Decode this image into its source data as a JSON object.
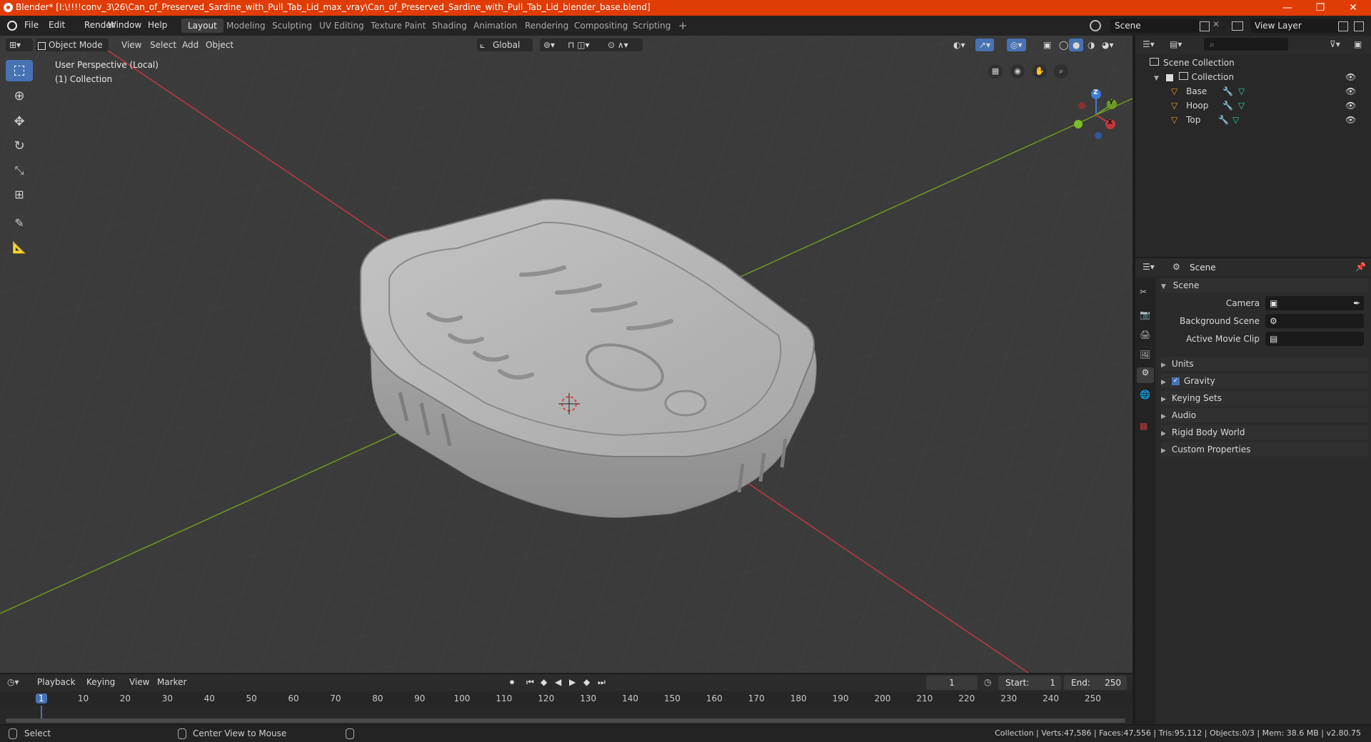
{
  "window": {
    "title": "Blender* [I:\\!!!!conv_3\\26\\Can_of_Preserved_Sardine_with_Pull_Tab_Lid_max_vray\\Can_of_Preserved_Sardine_with_Pull_Tab_Lid_blender_base.blend]",
    "minimize": "—",
    "restore": "❐",
    "close": "✕"
  },
  "menubar": {
    "items": [
      "File",
      "Edit",
      "Render",
      "Window",
      "Help"
    ],
    "workspaces": [
      "Layout",
      "Modeling",
      "Sculpting",
      "UV Editing",
      "Texture Paint",
      "Shading",
      "Animation",
      "Rendering",
      "Compositing",
      "Scripting"
    ],
    "add_tab": "+",
    "scene_label": "Scene",
    "view_layer_label": "View Layer"
  },
  "viewport_header": {
    "mode": "Object Mode",
    "menus": [
      "View",
      "Select",
      "Add",
      "Object"
    ],
    "orientation": "Global"
  },
  "viewport": {
    "perspective": "User Perspective (Local)",
    "collection": "(1) Collection",
    "gizmo": {
      "z": "Z",
      "y": "Y",
      "x": "X"
    }
  },
  "outliner": {
    "root": "Scene Collection",
    "collection": "Collection",
    "objects": [
      "Base",
      "Hoop",
      "Top"
    ]
  },
  "properties": {
    "header": "Scene",
    "panel": "Scene",
    "fields": [
      {
        "label": "Camera"
      },
      {
        "label": "Background Scene"
      },
      {
        "label": "Active Movie Clip"
      }
    ],
    "sections": [
      "Units",
      "Gravity",
      "Keying Sets",
      "Audio",
      "Rigid Body World",
      "Custom Properties"
    ],
    "gravity_checked": true
  },
  "timeline": {
    "menus": [
      "Playback",
      "Keying",
      "View",
      "Marker"
    ],
    "current_frame": "1",
    "start_label": "Start:",
    "start": "1",
    "end_label": "End:",
    "end": "250",
    "ticks": [
      "1",
      "10",
      "20",
      "30",
      "40",
      "50",
      "60",
      "70",
      "80",
      "90",
      "100",
      "110",
      "120",
      "130",
      "140",
      "150",
      "160",
      "170",
      "180",
      "190",
      "200",
      "210",
      "220",
      "230",
      "240",
      "250"
    ]
  },
  "statusbar": {
    "left": "Select",
    "middle": "Center View to Mouse",
    "right": "Collection | Verts:47,586 | Faces:47,556 | Tris:95,112 | Objects:0/3 | Mem: 38.6 MB | v2.80.75"
  },
  "colors": {
    "title_bar": "#e03c06",
    "accent": "#4772b3",
    "viewport_bg": "#3b3b3b",
    "axis_x": "#c0383e",
    "axis_y": "#6e9a24"
  }
}
